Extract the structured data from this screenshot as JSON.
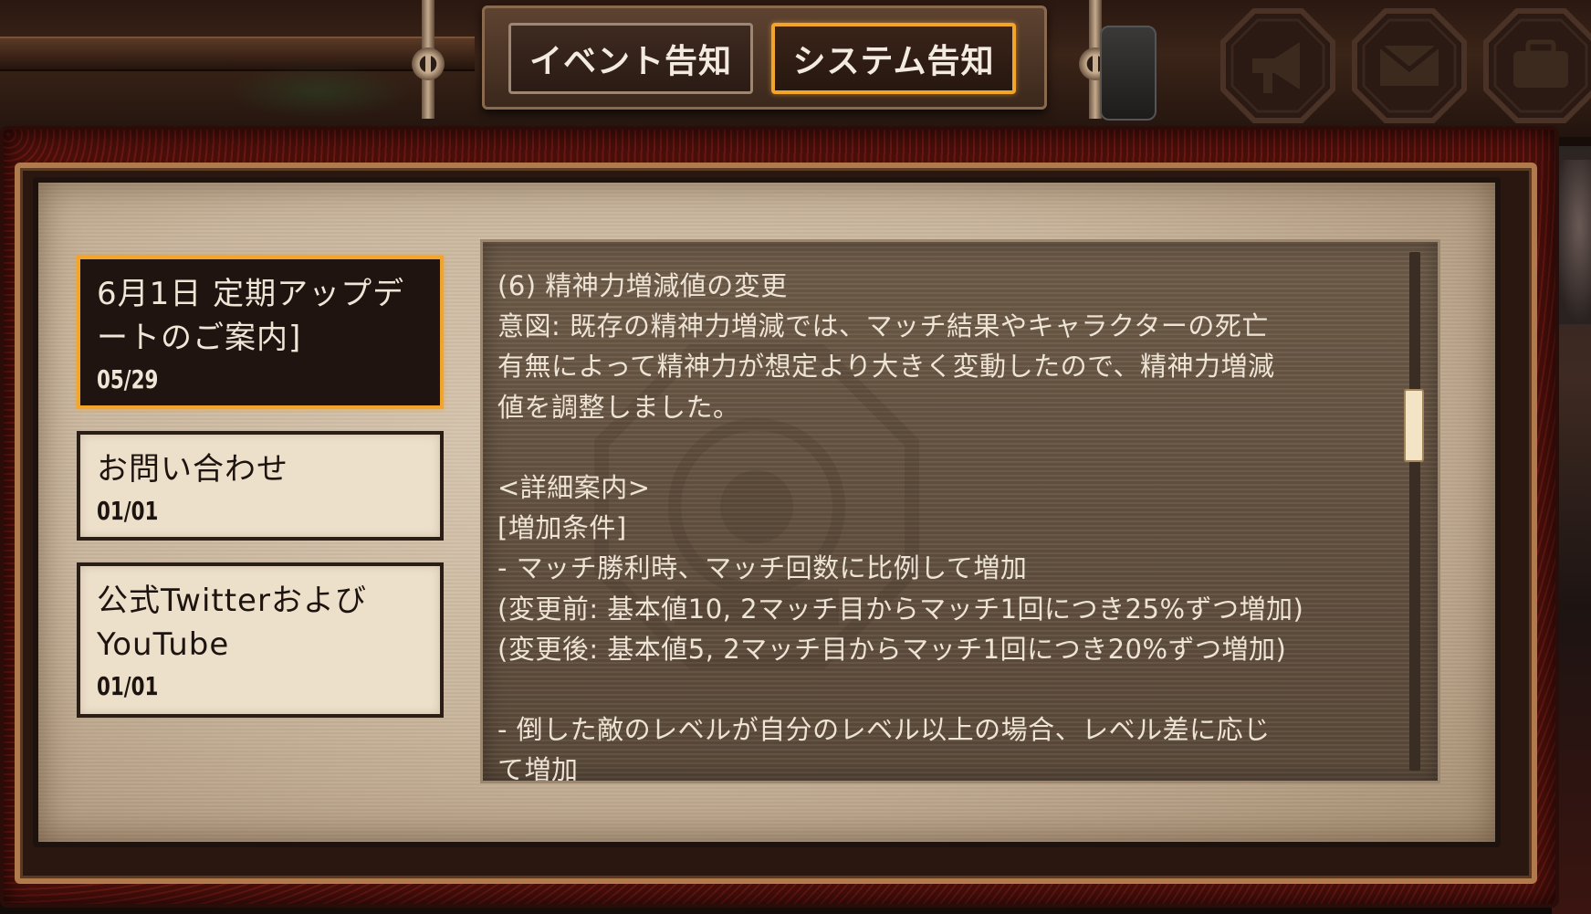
{
  "tabs": {
    "event_label": "イベント告知",
    "system_label": "システム告知",
    "active": "system"
  },
  "header_buttons": [
    {
      "icon": "megaphone-icon"
    },
    {
      "icon": "mail-icon"
    },
    {
      "icon": "bag-icon"
    }
  ],
  "notices": [
    {
      "title": "6月1日 定期アップデートのご案内]",
      "date": "05/29",
      "selected": true
    },
    {
      "title": "お問い合わせ",
      "date": "01/01",
      "selected": false
    },
    {
      "title": "公式TwitterおよびYouTube",
      "date": "01/01",
      "selected": false
    }
  ],
  "content": {
    "body": "(6) 精神力増減値の変更\n意図: 既存の精神力増減では、マッチ結果やキャラクターの死亡\n有無によって精神力が想定より大きく変動したので、精神力増減\n値を調整しました。\n\n<詳細案内>\n[増加条件]\n- マッチ勝利時、マッチ回数に比例して増加\n(変更前: 基本値10, 2マッチ目からマッチ1回につき25%ずつ増加)\n(変更後: 基本値5, 2マッチ目からマッチ1回につき20%ずつ増加)\n\n- 倒した敵のレベルが自分のレベル以上の場合、レベル差に応じ\nて増加"
  },
  "colors": {
    "accent": "#f2a52a",
    "selected_bg": "#1f1410",
    "item_bg": "#ede0cb",
    "content_bg": "#62503f",
    "content_text": "#eee4d6",
    "frame_red": "#6b1812"
  }
}
